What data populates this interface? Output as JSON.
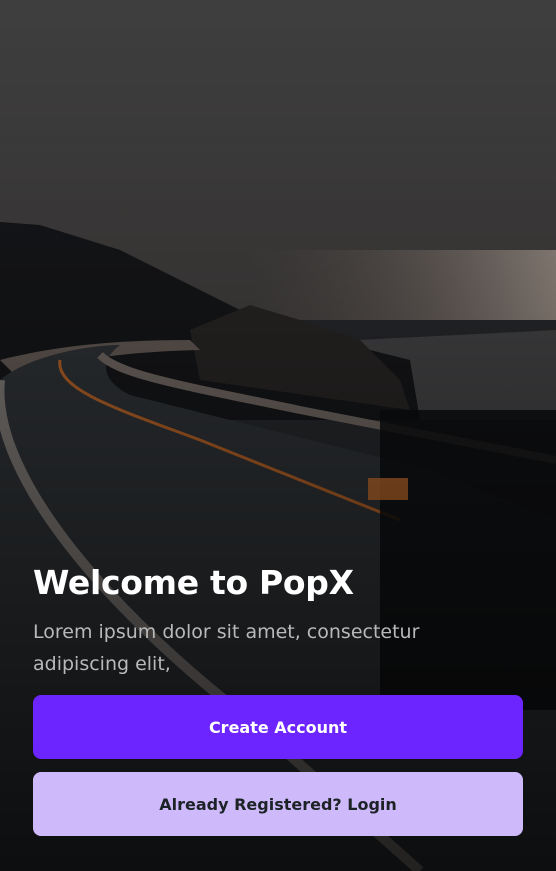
{
  "welcome": {
    "title": "Welcome to PopX",
    "subtitle": "Lorem ipsum dolor sit amet, consectetur adipiscing elit,"
  },
  "buttons": {
    "create_account": "Create Account",
    "login": "Already Registered? Login"
  },
  "colors": {
    "primary": "#6C25FF",
    "secondary": "#CEBAFB"
  }
}
